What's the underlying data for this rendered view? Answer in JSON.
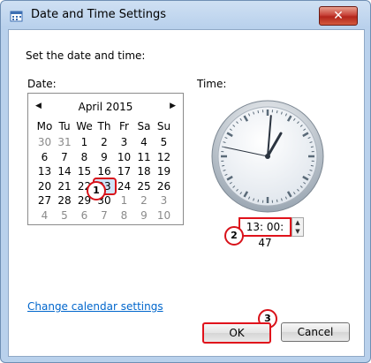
{
  "window": {
    "title": "Date and Time Settings",
    "close_glyph": "✕"
  },
  "instruction": "Set the date and time:",
  "labels": {
    "date_label": "Date:",
    "time_label": "Time:"
  },
  "calendar": {
    "month": "April 2015",
    "prev_glyph": "◀",
    "next_glyph": "▶",
    "days_of_week": [
      "Mo",
      "Tu",
      "We",
      "Th",
      "Fr",
      "Sa",
      "Su"
    ],
    "weeks": [
      [
        {
          "d": "30",
          "o": true
        },
        {
          "d": "31",
          "o": true
        },
        {
          "d": "1"
        },
        {
          "d": "2"
        },
        {
          "d": "3"
        },
        {
          "d": "4"
        },
        {
          "d": "5"
        }
      ],
      [
        {
          "d": "6"
        },
        {
          "d": "7"
        },
        {
          "d": "8"
        },
        {
          "d": "9"
        },
        {
          "d": "10"
        },
        {
          "d": "11"
        },
        {
          "d": "12"
        }
      ],
      [
        {
          "d": "13"
        },
        {
          "d": "14"
        },
        {
          "d": "15"
        },
        {
          "d": "16"
        },
        {
          "d": "17"
        },
        {
          "d": "18"
        },
        {
          "d": "19"
        }
      ],
      [
        {
          "d": "20"
        },
        {
          "d": "21"
        },
        {
          "d": "22"
        },
        {
          "d": "23",
          "sel": true
        },
        {
          "d": "24"
        },
        {
          "d": "25"
        },
        {
          "d": "26"
        }
      ],
      [
        {
          "d": "27"
        },
        {
          "d": "28"
        },
        {
          "d": "29"
        },
        {
          "d": "30"
        },
        {
          "d": "1",
          "o": true
        },
        {
          "d": "2",
          "o": true
        },
        {
          "d": "3",
          "o": true
        }
      ],
      [
        {
          "d": "4",
          "o": true
        },
        {
          "d": "5",
          "o": true
        },
        {
          "d": "6",
          "o": true
        },
        {
          "d": "7",
          "o": true
        },
        {
          "d": "8",
          "o": true
        },
        {
          "d": "9",
          "o": true
        },
        {
          "d": "10",
          "o": true
        }
      ]
    ]
  },
  "clock": {
    "hour": 13,
    "minute": 0,
    "second": 47
  },
  "time": {
    "value": "13: 00: 47",
    "up_glyph": "▲",
    "down_glyph": "▼"
  },
  "markers": {
    "m1": "1",
    "m2": "2",
    "m3": "3"
  },
  "links": {
    "change_calendar": "Change calendar settings"
  },
  "buttons": {
    "ok": "OK",
    "cancel": "Cancel"
  },
  "colors": {
    "highlight": "#e0121b",
    "link": "#0066cc"
  }
}
